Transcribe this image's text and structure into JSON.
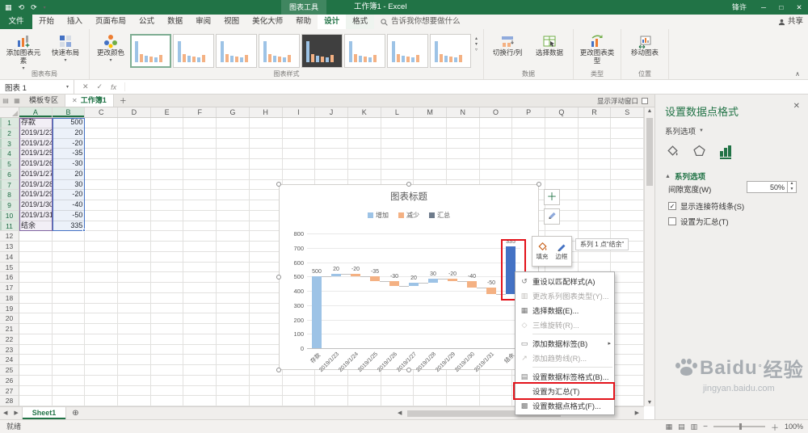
{
  "colors": {
    "excel_green": "#217346",
    "increase": "#9DC3E6",
    "decrease": "#F4B183",
    "selected_point": "#4472C4",
    "annotation_red": "#E3131B"
  },
  "titlebar": {
    "context_label": "图表工具",
    "title": "工作簿1 - Excel",
    "user": "锋许"
  },
  "tabs": {
    "file": "文件",
    "main": [
      "开始",
      "插入",
      "页面布局",
      "公式",
      "数据",
      "审阅",
      "视图",
      "美化大师",
      "帮助"
    ],
    "contextual": [
      "设计",
      "格式"
    ],
    "active": "设计",
    "search": "告诉我你想要做什么",
    "share": "共享"
  },
  "ribbon": {
    "add_chart_element": "添加图表元素",
    "quick_layout": "快速布局",
    "change_colors": "更改颜色",
    "switch_row_col": "切换行/列",
    "select_data": "选择数据",
    "change_chart_type": "更改图表类型",
    "move_chart": "移动图表",
    "style_thumbnails": [
      "light",
      "light",
      "light",
      "light",
      "dark",
      "light",
      "light",
      "light"
    ],
    "groups": {
      "chart_layout": "图表布局",
      "chart_styles": "图表样式",
      "data": "数据",
      "type": "类型",
      "location": "位置"
    }
  },
  "formula_bar": {
    "name_box": "图表 1",
    "fx": "fx"
  },
  "doc_tabs": {
    "tab1": "模板专区",
    "tab2": "工作簿1",
    "float_option": "显示浮动窗口"
  },
  "sheet": {
    "columns": [
      "A",
      "B",
      "C",
      "D",
      "E",
      "F",
      "G",
      "H",
      "I",
      "J",
      "K",
      "L",
      "M",
      "N",
      "O",
      "P",
      "Q",
      "R",
      "S"
    ],
    "row_count": 28,
    "highlight_rows": 11,
    "cells": {
      "A1": "存款",
      "B1": "500",
      "A2": "2019/1/23",
      "B2": "20",
      "A3": "2019/1/24",
      "B3": "-20",
      "A4": "2019/1/25",
      "B4": "-35",
      "A5": "2019/1/26",
      "B5": "-30",
      "A6": "2019/1/27",
      "B6": "20",
      "A7": "2019/1/28",
      "B7": "30",
      "A8": "2019/1/29",
      "B8": "-20",
      "A9": "2019/1/30",
      "B9": "-40",
      "A10": "2019/1/31",
      "B10": "-50",
      "A11": "结余",
      "B11": "335"
    },
    "sheet_tab": "Sheet1"
  },
  "chart_data": {
    "type": "bar",
    "subtype": "waterfall",
    "title": "图表标题",
    "legend": [
      {
        "label": "增加",
        "color": "#9DC3E6"
      },
      {
        "label": "减少",
        "color": "#F4B183"
      },
      {
        "label": "汇总",
        "color": "#6E7B8B"
      }
    ],
    "categories": [
      "存款",
      "2019/1/23",
      "2019/1/24",
      "2019/1/25",
      "2019/1/26",
      "2019/1/27",
      "2019/1/28",
      "2019/1/29",
      "2019/1/30",
      "2019/1/31",
      "结余"
    ],
    "values": [
      500,
      20,
      -20,
      -35,
      -30,
      20,
      30,
      -20,
      -40,
      -50,
      335
    ],
    "selected_point": "结余",
    "ylim": [
      0,
      800
    ],
    "ytick_step": 100,
    "grid": true,
    "legend_position": "top",
    "connector_lines": true
  },
  "mini_toolbar": {
    "tooltip": "系列 1 点“结余”",
    "fill": "填充",
    "border": "边框"
  },
  "context_menu": {
    "separators_after": [
      3,
      5
    ],
    "items": [
      {
        "label": "重设以匹配样式(A)",
        "disabled": false,
        "icon": "reset",
        "highlighted": false,
        "submenu": false
      },
      {
        "label": "更改系列图表类型(Y)...",
        "disabled": true,
        "icon": "chart-type",
        "highlighted": false,
        "submenu": false
      },
      {
        "label": "选择数据(E)...",
        "disabled": false,
        "icon": "select-data",
        "highlighted": false,
        "submenu": false
      },
      {
        "label": "三维旋转(R)...",
        "disabled": true,
        "icon": "rotate-3d",
        "highlighted": false,
        "submenu": false
      },
      {
        "label": "添加数据标签(B)",
        "disabled": false,
        "icon": "data-label",
        "highlighted": false,
        "submenu": true
      },
      {
        "label": "添加趋势线(R)...",
        "disabled": true,
        "icon": "trendline",
        "highlighted": false,
        "submenu": false
      },
      {
        "label": "设置数据标签格式(B)...",
        "disabled": false,
        "icon": "format-label",
        "highlighted": false,
        "submenu": false
      },
      {
        "label": "设置为汇总(T)",
        "disabled": false,
        "icon": "none",
        "highlighted": true,
        "submenu": false
      },
      {
        "label": "设置数据点格式(F)...",
        "disabled": false,
        "icon": "format-point",
        "highlighted": false,
        "submenu": false
      }
    ]
  },
  "pane": {
    "title": "设置数据点格式",
    "series_selector": "系列选项",
    "section": "系列选项",
    "gap_width_label": "间隙宽度(W)",
    "gap_width_value": "50%",
    "connector_label": "显示连接符线条(S)",
    "connector_checked": true,
    "total_label": "设置为汇总(T)",
    "total_checked": false
  },
  "status_bar": {
    "ready": "就绪",
    "zoom": "100%"
  },
  "watermark": {
    "brand": "Baidu",
    "degree": "°",
    "suffix": "经验",
    "url": "jingyan.baidu.com"
  }
}
